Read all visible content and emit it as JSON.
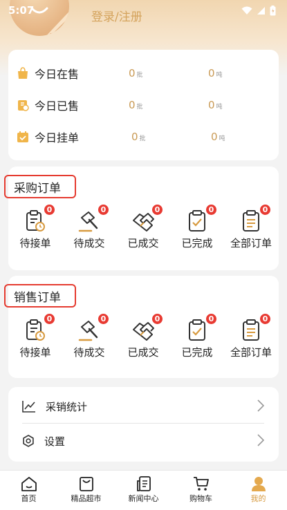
{
  "status_bar": {
    "time": "5:07"
  },
  "header": {
    "login_label": "登录/注册"
  },
  "today": {
    "rows": [
      {
        "label": "今日在售",
        "count_value": "0",
        "count_unit": "批",
        "weight_value": "0",
        "weight_unit": "吨"
      },
      {
        "label": "今日已售",
        "count_value": "0",
        "count_unit": "批",
        "weight_value": "0",
        "weight_unit": "吨"
      },
      {
        "label": "今日挂单",
        "count_value": "0",
        "count_unit": "批",
        "weight_value": "0",
        "weight_unit": "吨"
      }
    ]
  },
  "purchase": {
    "title": "采购订单",
    "items": [
      {
        "label": "待接单",
        "badge": "0"
      },
      {
        "label": "待成交",
        "badge": "0"
      },
      {
        "label": "已成交",
        "badge": "0"
      },
      {
        "label": "已完成",
        "badge": "0"
      },
      {
        "label": "全部订单",
        "badge": "0"
      }
    ]
  },
  "sales": {
    "title": "销售订单",
    "items": [
      {
        "label": "待接单",
        "badge": "0"
      },
      {
        "label": "待成交",
        "badge": "0"
      },
      {
        "label": "已成交",
        "badge": "0"
      },
      {
        "label": "已完成",
        "badge": "0"
      },
      {
        "label": "全部订单",
        "badge": "0"
      }
    ]
  },
  "menu": {
    "stats_label": "采销统计",
    "settings_label": "设置"
  },
  "tabbar": {
    "items": [
      {
        "label": "首页"
      },
      {
        "label": "精品超市"
      },
      {
        "label": "新闻中心"
      },
      {
        "label": "购物车"
      },
      {
        "label": "我的"
      }
    ]
  },
  "colors": {
    "accent": "#d79a3f",
    "badge": "#e83a32",
    "highlight_border": "#e53a2f"
  }
}
